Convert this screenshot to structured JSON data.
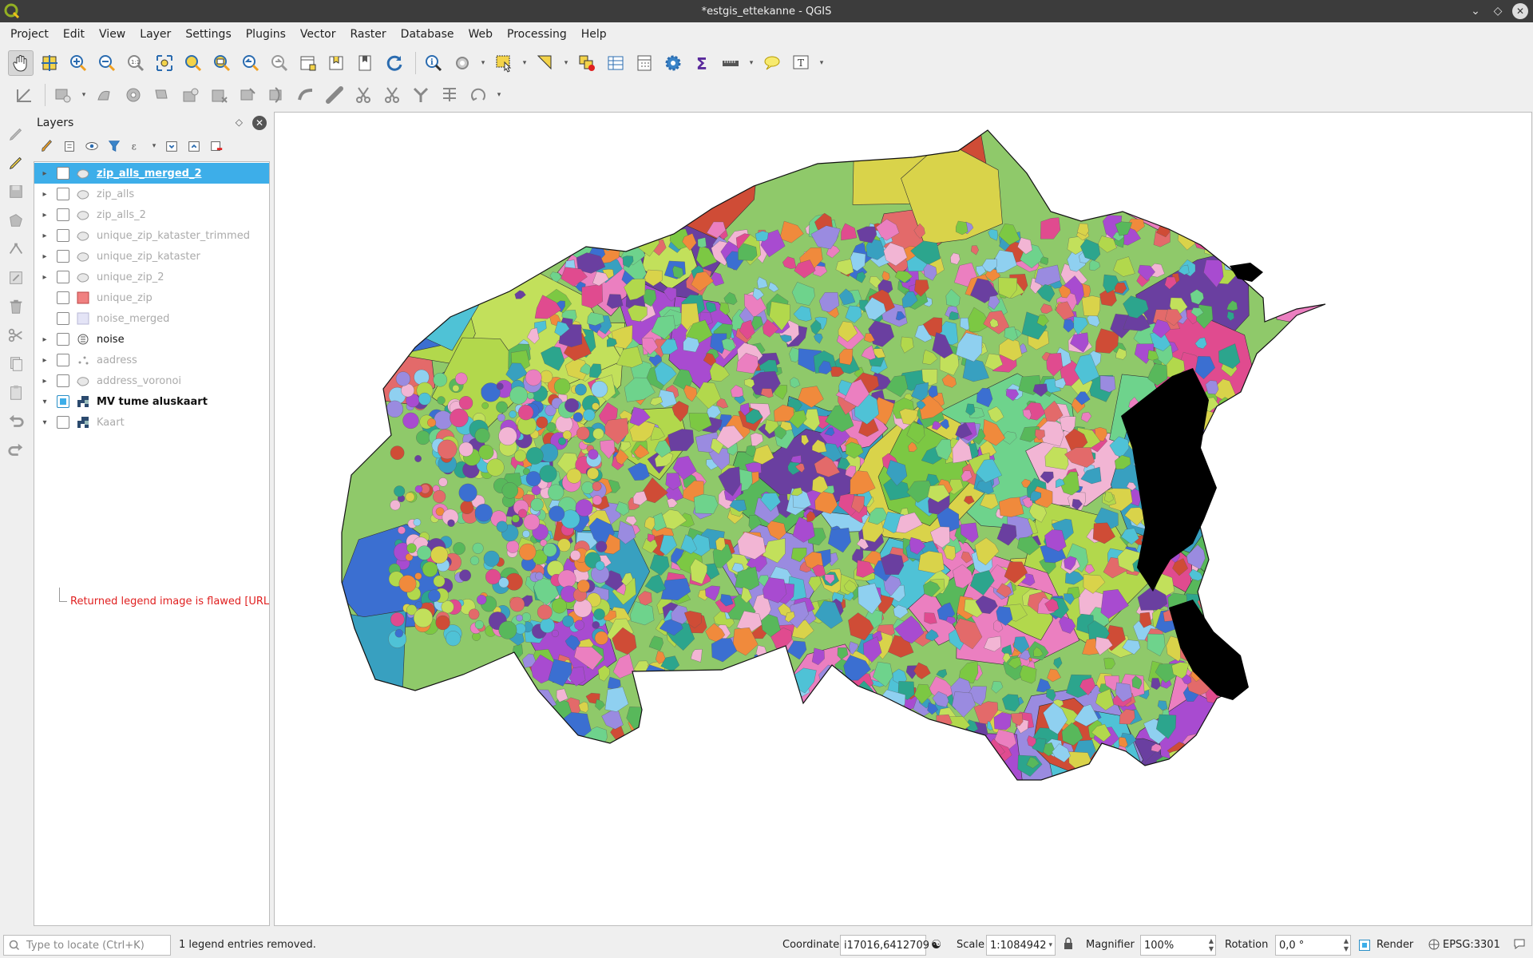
{
  "window": {
    "title": "*estgis_ettekanne - QGIS"
  },
  "menu": [
    "Project",
    "Edit",
    "View",
    "Layer",
    "Settings",
    "Plugins",
    "Vector",
    "Raster",
    "Database",
    "Web",
    "Processing",
    "Help"
  ],
  "layers_panel": {
    "title": "Layers",
    "layers": [
      {
        "name": "zip_alls_merged_2",
        "checked": false,
        "selected": true,
        "icon": "polygon-layer-icon"
      },
      {
        "name": "zip_alls",
        "checked": false,
        "icon": "polygon-layer-icon"
      },
      {
        "name": "zip_alls_2",
        "checked": false,
        "icon": "polygon-layer-icon"
      },
      {
        "name": "unique_zip_kataster_trimmed",
        "checked": false,
        "icon": "polygon-layer-icon"
      },
      {
        "name": "unique_zip_kataster",
        "checked": false,
        "icon": "polygon-layer-icon"
      },
      {
        "name": "unique_zip_2",
        "checked": false,
        "icon": "polygon-layer-icon"
      },
      {
        "name": "unique_zip",
        "checked": false,
        "icon": "red-fill-icon"
      },
      {
        "name": "noise_merged",
        "checked": false,
        "icon": "lavender-fill-icon"
      },
      {
        "name": "noise",
        "checked": false,
        "icon": "categorized-icon"
      },
      {
        "name": "aadress",
        "checked": false,
        "icon": "point-layer-icon"
      },
      {
        "name": "address_voronoi",
        "checked": false,
        "icon": "polygon-layer-icon"
      },
      {
        "name": "MV tume aluskaart",
        "checked": true,
        "icon": "wms-icon"
      },
      {
        "name": "Kaart",
        "checked": false,
        "icon": "wms-icon"
      }
    ],
    "legend_error": "Returned legend image is flawed [URL"
  },
  "statusbar": {
    "locator_placeholder": "Type to locate (Ctrl+K)",
    "message": "1 legend entries removed.",
    "coordinate_label": "Coordinate",
    "coordinate_value": "i17016,6412709",
    "scale_label": "Scale",
    "scale_value": "1:1084942",
    "magnifier_label": "Magnifier",
    "magnifier_value": "100%",
    "rotation_label": "Rotation",
    "rotation_value": "0,0 °",
    "render_label": "Render",
    "crs": "EPSG:3301"
  },
  "colors": {
    "selection": "#3daee9",
    "error_text": "#e02020",
    "coast": "#000000"
  }
}
